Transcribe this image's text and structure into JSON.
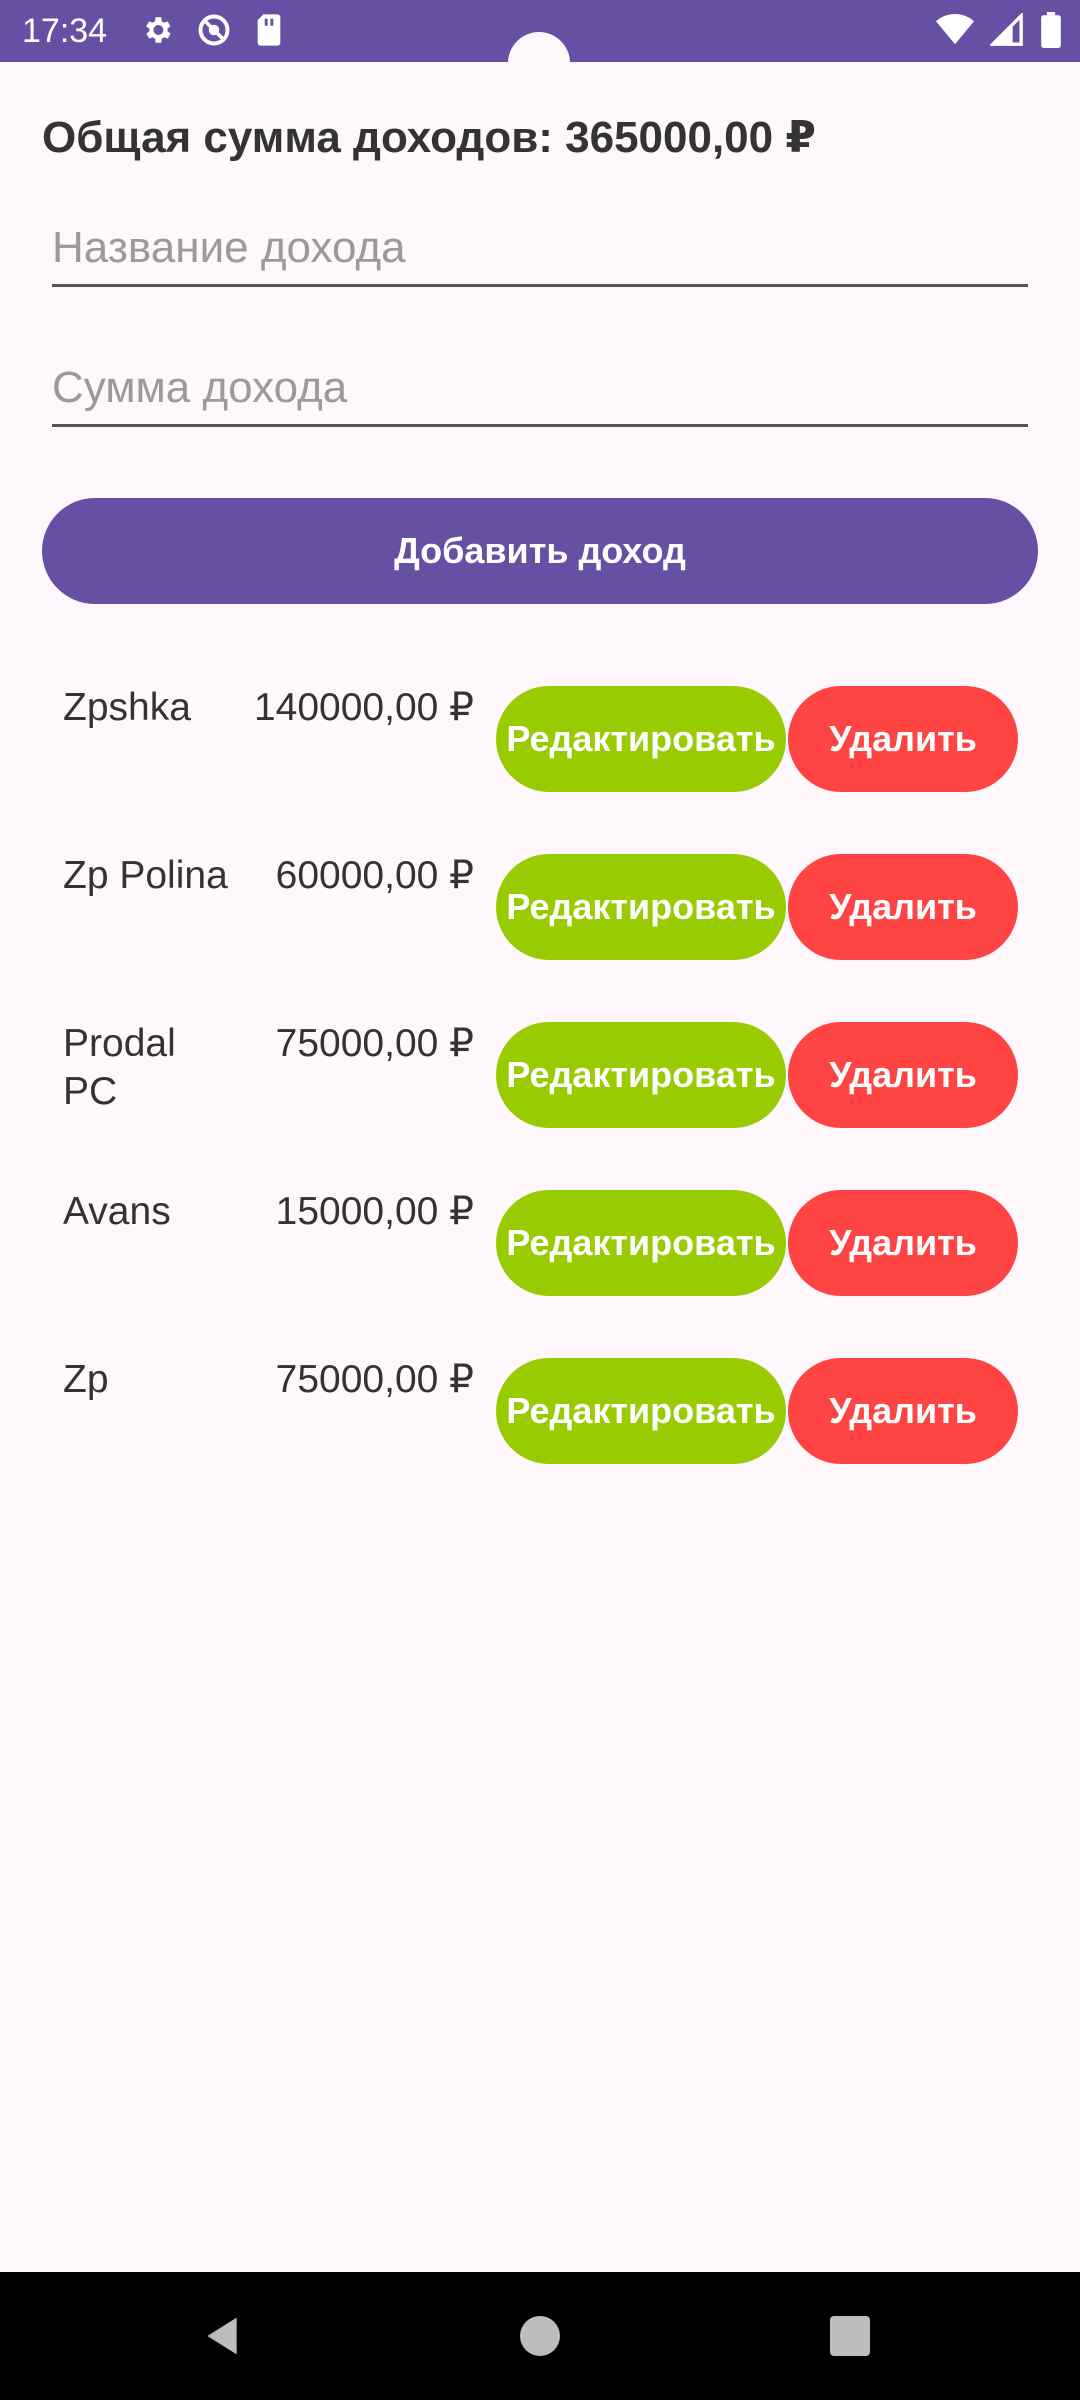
{
  "status_bar": {
    "time": "17:34",
    "left_icons": [
      "gear-icon",
      "no-disturb-icon",
      "sd-card-icon"
    ],
    "right_icons": [
      "wifi-icon",
      "signal-icon",
      "battery-icon"
    ],
    "background": "#6750A4"
  },
  "summary": {
    "total_text": "Общая сумма доходов: 365000,00 ₽"
  },
  "form": {
    "name_placeholder": "Название дохода",
    "name_value": "",
    "sum_placeholder": "Сумма дохода",
    "sum_value": "",
    "add_button_label": "Добавить доход"
  },
  "incomes": [
    {
      "name": "Zpshka",
      "amount": "140000,00 ₽",
      "edit_label": "Редактировать",
      "delete_label": "Удалить"
    },
    {
      "name": "Zp Polina",
      "amount": "60000,00 ₽",
      "edit_label": "Редактировать",
      "delete_label": "Удалить"
    },
    {
      "name": "Prodal PC",
      "amount": "75000,00 ₽",
      "edit_label": "Редактировать",
      "delete_label": "Удалить"
    },
    {
      "name": "Avans",
      "amount": "15000,00 ₽",
      "edit_label": "Редактировать",
      "delete_label": "Удалить"
    },
    {
      "name": "Zp",
      "amount": "75000,00 ₽",
      "edit_label": "Редактировать",
      "delete_label": "Удалить"
    }
  ],
  "colors": {
    "accent": "#6750A4",
    "edit": "#99CC00",
    "delete": "#FF4444",
    "background": "#FEF7FB"
  }
}
